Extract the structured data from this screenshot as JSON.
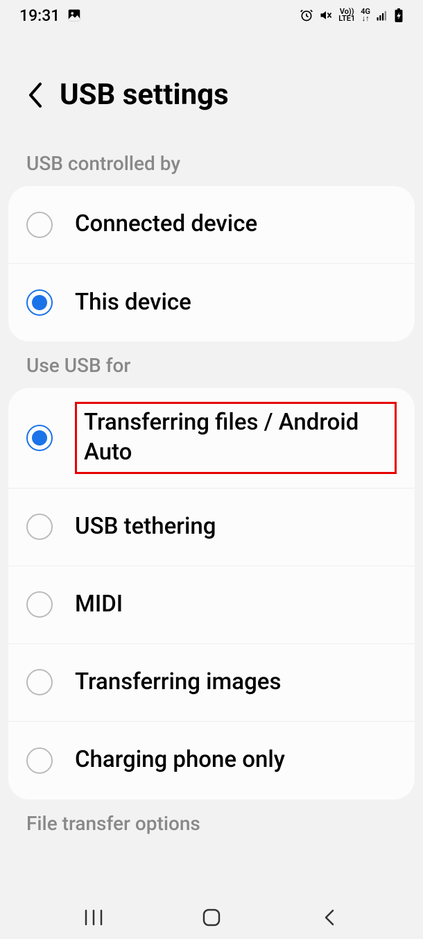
{
  "statusbar": {
    "time": "19:31",
    "volte": "Vo))",
    "lte": "LTE1",
    "net": "4G"
  },
  "header": {
    "title": "USB settings"
  },
  "sections": {
    "controlled_by": {
      "title": "USB controlled by",
      "options": {
        "connected": {
          "label": "Connected device"
        },
        "this": {
          "label": "This device"
        }
      }
    },
    "use_for": {
      "title": "Use USB for",
      "options": {
        "transfer_files": {
          "label": "Transferring files / Android Auto"
        },
        "tethering": {
          "label": "USB tethering"
        },
        "midi": {
          "label": "MIDI"
        },
        "transfer_images": {
          "label": "Transferring images"
        },
        "charging": {
          "label": "Charging phone only"
        }
      }
    },
    "file_transfer": {
      "title": "File transfer options"
    }
  }
}
